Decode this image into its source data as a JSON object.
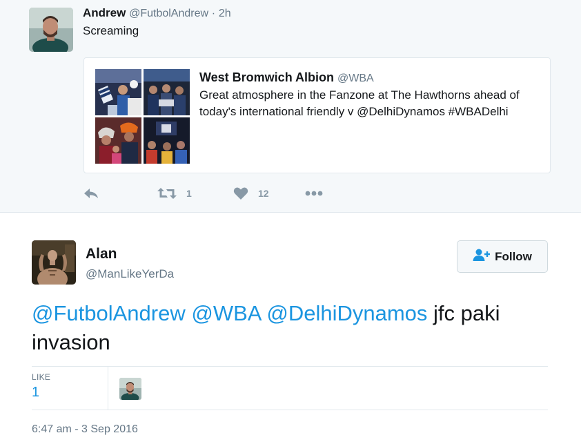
{
  "parent_tweet": {
    "name": "Andrew",
    "handle": "@FutbolAndrew",
    "separator": "·",
    "time": "2h",
    "text": "Screaming",
    "quoted": {
      "name": "West Bromwich Albion",
      "handle": "@WBA",
      "text": "Great atmosphere in the Fanzone at The Hawthorns ahead of today's international friendly v @DelhiDynamos #WBADelhi"
    },
    "actions": {
      "retweet_count": "1",
      "like_count": "12"
    }
  },
  "main_tweet": {
    "name": "Alan",
    "handle": "@ManLikeYerDa",
    "follow_label": "Follow",
    "mentions": [
      "@FutbolAndrew",
      "@WBA",
      "@DelhiDynamos"
    ],
    "text_rest": "jfc paki invasion",
    "likes_label": "LIKE",
    "likes_count": "1",
    "timestamp": "6:47 am - 3 Sep 2016"
  },
  "colors": {
    "link": "#1b95e0",
    "secondary": "#657786",
    "icon": "#8899a6",
    "parent_bg": "#f5f8fa"
  },
  "icons": [
    "reply-icon",
    "retweet-icon",
    "heart-icon",
    "more-icon",
    "follow-user-icon"
  ]
}
